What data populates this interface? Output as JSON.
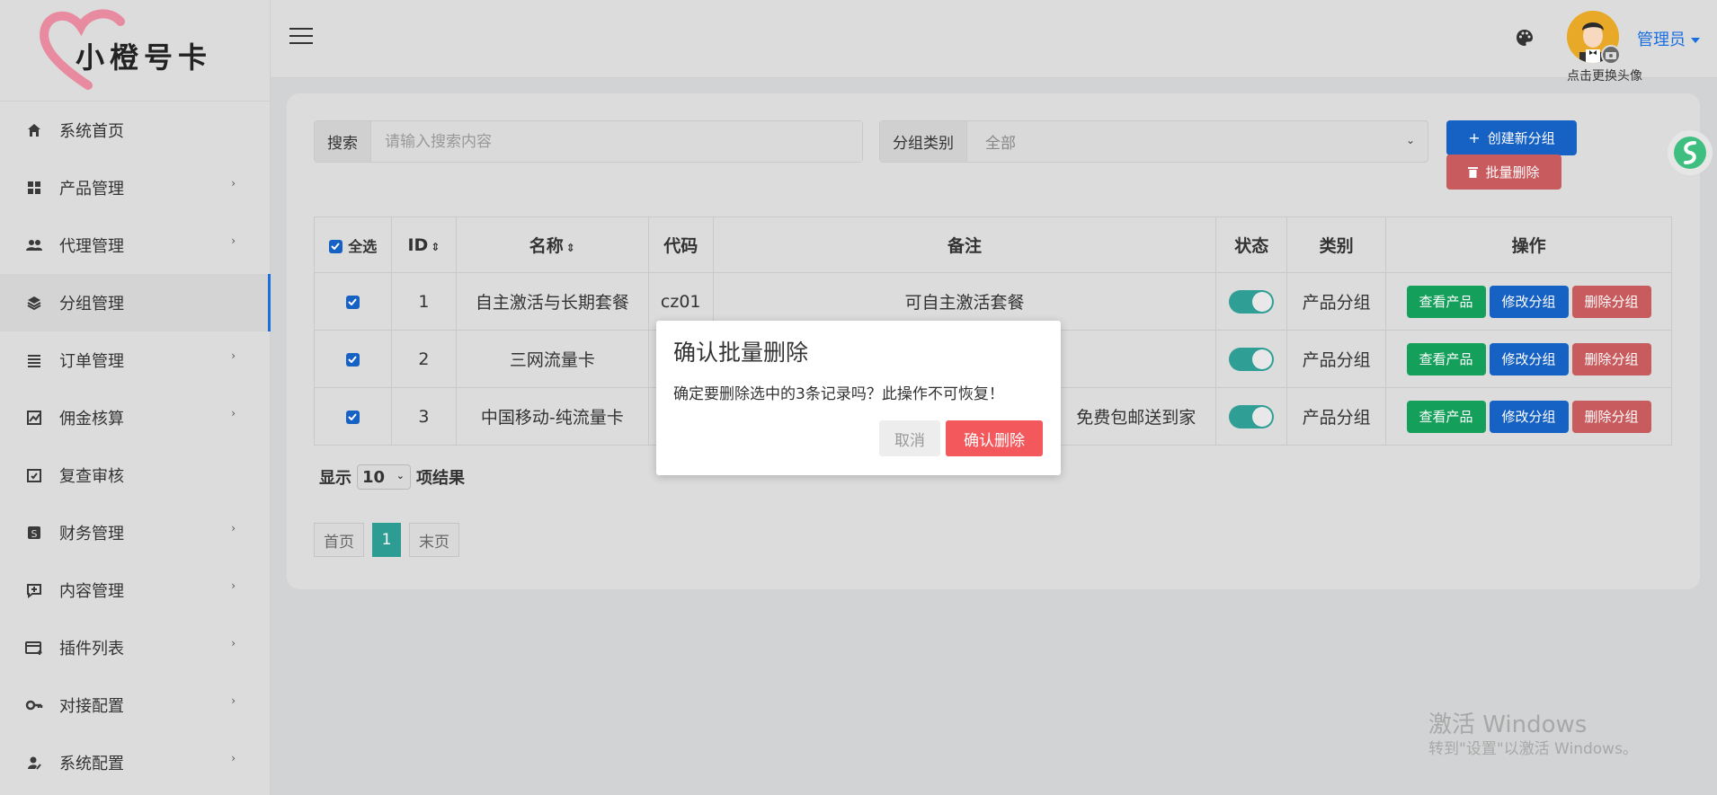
{
  "logo": {
    "text": "小橙号卡"
  },
  "sidebar": {
    "items": [
      {
        "label": "系统首页",
        "icon": "home-icon"
      },
      {
        "label": "产品管理",
        "icon": "grid-icon"
      },
      {
        "label": "代理管理",
        "icon": "users-icon"
      },
      {
        "label": "分组管理",
        "icon": "layers-icon",
        "active": true
      },
      {
        "label": "订单管理",
        "icon": "list-icon"
      },
      {
        "label": "佣金核算",
        "icon": "chart-icon"
      },
      {
        "label": "复查审核",
        "icon": "calendar-check-icon"
      },
      {
        "label": "财务管理",
        "icon": "dollar-icon"
      },
      {
        "label": "内容管理",
        "icon": "comment-plus-icon"
      },
      {
        "label": "插件列表",
        "icon": "card-plus-icon"
      },
      {
        "label": "对接配置",
        "icon": "key-icon"
      },
      {
        "label": "系统配置",
        "icon": "user-gear-icon"
      }
    ]
  },
  "header": {
    "user": "管理员",
    "avatar_caption": "点击更换头像"
  },
  "search": {
    "label": "搜索",
    "placeholder": "请输入搜索内容"
  },
  "filter": {
    "label": "分组类别",
    "value": "全部"
  },
  "actions": {
    "create": "创建新分组",
    "batch_delete": "批量删除"
  },
  "table": {
    "headers": {
      "select_all": "全选",
      "id": "ID",
      "name": "名称",
      "code": "代码",
      "remark": "备注",
      "status": "状态",
      "category": "类别",
      "ops": "操作"
    },
    "rows": [
      {
        "id": "1",
        "name": "自主激活与长期套餐",
        "code": "cz01",
        "remark": "可自主激活套餐",
        "category": "产品分组"
      },
      {
        "id": "2",
        "name": "三网流量卡",
        "code": "",
        "remark": "",
        "category": "产品分组"
      },
      {
        "id": "3",
        "name": "中国移动-纯流量卡",
        "code": "",
        "remark": "免费包邮送到家",
        "category": "产品分组"
      }
    ],
    "op_labels": {
      "view": "查看产品",
      "edit": "修改分组",
      "delete": "删除分组"
    }
  },
  "page_size": {
    "prefix": "显示",
    "value": "10",
    "suffix": "项结果"
  },
  "pager": {
    "first": "首页",
    "current": "1",
    "last": "末页"
  },
  "modal": {
    "title": "确认批量删除",
    "message": "确定要删除选中的3条记录吗？此操作不可恢复！",
    "cancel": "取消",
    "confirm": "确认删除"
  },
  "watermark": {
    "title": "激活 Windows",
    "subtitle": "转到\"设置\"以激活 Windows。"
  },
  "colors": {
    "primary": "#1661c4",
    "success": "#14a05a",
    "danger": "#c85b5e",
    "teal": "#2d9d94",
    "modal_confirm": "#f3595c"
  }
}
